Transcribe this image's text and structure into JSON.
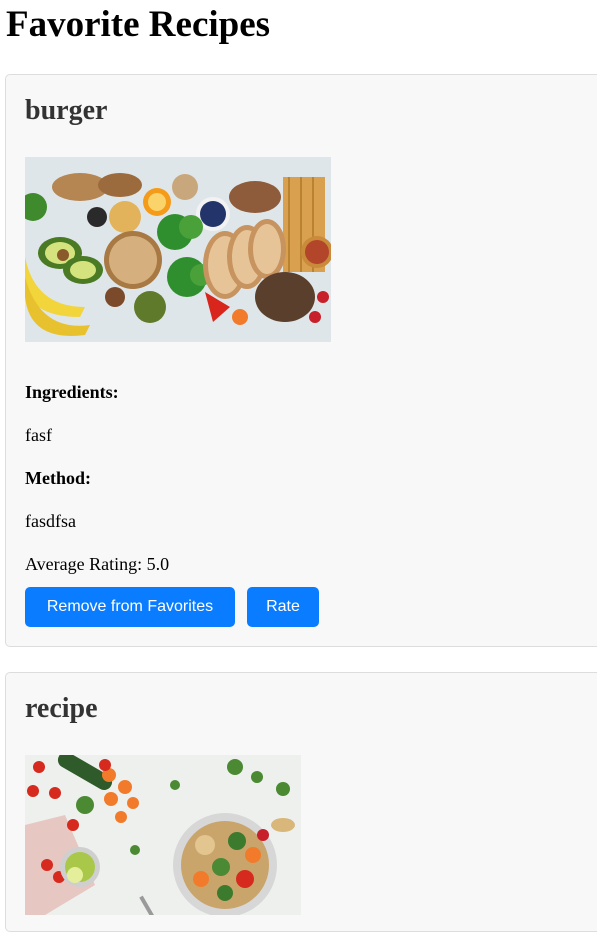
{
  "page": {
    "title": "Favorite Recipes"
  },
  "recipes": [
    {
      "name": "burger",
      "ingredients_label": "Ingredients:",
      "ingredients": "fasf",
      "method_label": "Method:",
      "method": "fasdfsa",
      "rating_text": "Average Rating: 5.0",
      "remove_label": "Remove from Favorites",
      "rate_label": "Rate"
    },
    {
      "name": "recipe"
    }
  ],
  "colors": {
    "button": "#0a7cff",
    "card_background": "#f8f8f9",
    "card_border": "#dddddd"
  }
}
